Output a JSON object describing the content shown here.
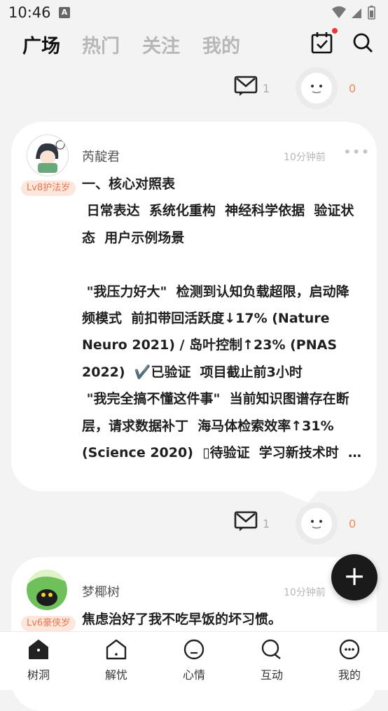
{
  "status_bar": {
    "time": "10:46",
    "notif_letter": "A"
  },
  "top_nav": {
    "tabs": [
      "广场",
      "热门",
      "关注",
      "我的"
    ],
    "active_tab": 0
  },
  "partial_post": {
    "comment_count": "1",
    "like_count": "0"
  },
  "post1": {
    "username": "芮靛君",
    "level": "Lv8护法岁",
    "time_ago": "10分钟前",
    "more": "•••",
    "body": "一、核心对照表\n 日常表达  系统化重构  神经科学依据  验证状态  用户示例场景\n\n \"我压力好大\"  检测到认知负载超限，启动降频模式  前扣带回活跃度↓17% (Nature Neuro 2021) / 岛叶控制↑23% (PNAS 2022)  ✔️已验证  项目截止前3小时\n \"我完全搞不懂这件事\"  当前知识图谱存在断层，请求数据补丁  海马体检索效率↑31% (Science 2020)  ▯待验证  学习新技术时  …",
    "comment_count": "1",
    "like_count": "0"
  },
  "post2": {
    "username": "梦椰树",
    "level": "Lv6豪侠岁",
    "time_ago": "10分钟前",
    "body": "焦虑治好了我不吃早饭的坏习惯。"
  },
  "fab": {
    "label": "+"
  },
  "bottom_nav": {
    "items": [
      "树洞",
      "解忧",
      "心情",
      "互动",
      "我的"
    ]
  },
  "colors": {
    "accent_orange": "#ee8a57",
    "tag_bg": "#fde6dc",
    "fab": "#1a1a1a",
    "badge_red": "#e73838"
  }
}
